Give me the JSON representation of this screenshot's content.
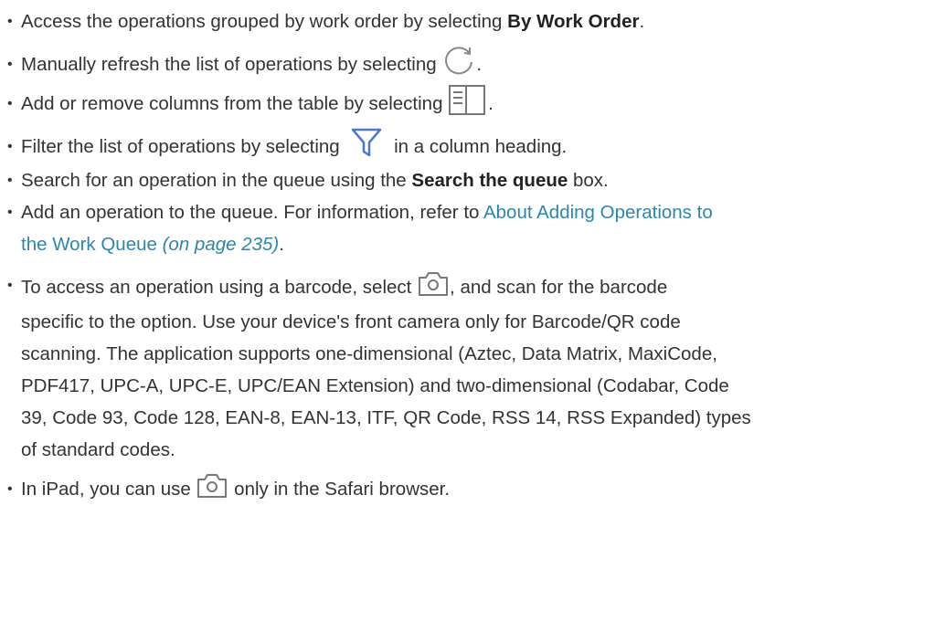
{
  "items": [
    {
      "text_before": "Access the operations grouped by work order by selecting ",
      "bold": "By Work Order",
      "text_after": "."
    },
    {
      "text_before": "Manually refresh the list of operations by selecting ",
      "icon": "refresh-icon",
      "text_after": "."
    },
    {
      "text_before": "Add or remove columns from the table by selecting ",
      "icon": "columns-icon",
      "text_after": "."
    },
    {
      "text_before": "Filter the list of operations by selecting ",
      "icon": "filter-icon",
      "text_after": " in a column heading."
    },
    {
      "text_before": "Search for an operation in the queue using the ",
      "bold": "Search the queue",
      "text_after": " box."
    },
    {
      "text_before": "Add an operation to the queue. For information, refer to ",
      "link_line1": "About Adding Operations to",
      "link_line2": "the Work Queue",
      "link_page": "(on page 235)",
      "text_after": "."
    },
    {
      "line1_before": "To access an operation using a barcode, select ",
      "icon": "camera-icon",
      "line1_after": ", and scan for the barcode",
      "line2": "specific to the option. Use your device's front camera only for Barcode/QR code",
      "line3": "scanning. The application supports one-dimensional (Aztec, Data Matrix, MaxiCode,",
      "line4": "PDF417, UPC-A, UPC-E, UPC/EAN Extension) and two-dimensional (Codabar, Code",
      "line5": "39, Code 93, Code 128, EAN-8, EAN-13, ITF, QR Code, RSS 14, RSS Expanded) types",
      "line6": "of standard codes."
    },
    {
      "text_before": "In iPad, you can use ",
      "icon": "camera-icon",
      "text_after": " only in the Safari browser."
    }
  ],
  "colors": {
    "text": "#333333",
    "link": "#2e86ab",
    "icon_stroke": "#888888",
    "filter_fill": "#4a79c9"
  }
}
